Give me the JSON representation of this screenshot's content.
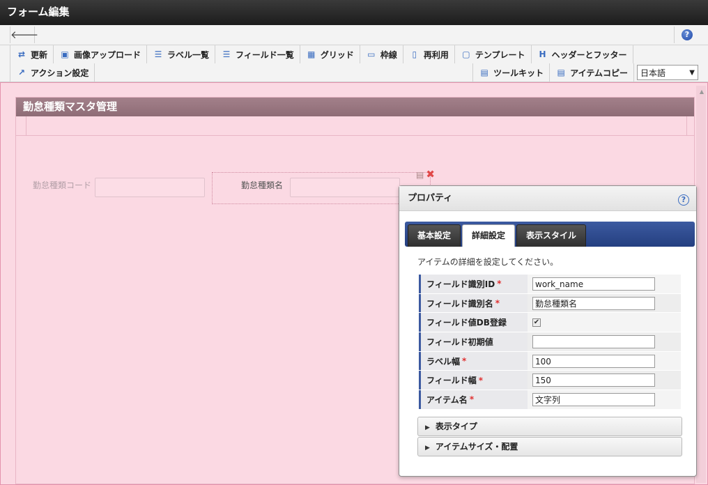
{
  "window": {
    "title": "フォーム編集"
  },
  "nav": {
    "back_icon": "arrow-left-icon",
    "help_label": "?"
  },
  "toolbar": {
    "row1": [
      {
        "label": "更新",
        "icon": "refresh-icon",
        "glyph": "⇄"
      },
      {
        "label": "画像アップロード",
        "icon": "image-upload-icon",
        "glyph": "▣"
      },
      {
        "label": "ラベル一覧",
        "icon": "list-icon",
        "glyph": "☰"
      },
      {
        "label": "フィールド一覧",
        "icon": "list-icon",
        "glyph": "☰"
      },
      {
        "label": "グリッド",
        "icon": "grid-icon",
        "glyph": "▦"
      },
      {
        "label": "枠線",
        "icon": "border-icon",
        "glyph": "▭"
      },
      {
        "label": "再利用",
        "icon": "document-icon",
        "glyph": "▯"
      },
      {
        "label": "テンプレート",
        "icon": "template-icon",
        "glyph": "▢"
      },
      {
        "label": "ヘッダーとフッター",
        "icon": "header-icon",
        "glyph": "H"
      }
    ],
    "row2_left": [
      {
        "label": "アクション設定",
        "icon": "action-icon",
        "glyph": "↗"
      }
    ],
    "row2_right": [
      {
        "label": "ツールキット",
        "icon": "toolbox-icon",
        "glyph": "▤"
      },
      {
        "label": "アイテムコピー",
        "icon": "toolbox-icon",
        "glyph": "▤"
      }
    ],
    "language": {
      "selected": "日本語"
    }
  },
  "form": {
    "title": "勤怠種類マスタ管理",
    "fields": [
      {
        "label": "勤怠種類コード"
      },
      {
        "label": "勤怠種類名"
      }
    ]
  },
  "properties": {
    "title": "プロパティ",
    "help_label": "?",
    "tabs": [
      {
        "label": "基本設定",
        "active": false
      },
      {
        "label": "詳細設定",
        "active": true
      },
      {
        "label": "表示スタイル",
        "active": false
      }
    ],
    "description": "アイテムの詳細を設定してください。",
    "rows": [
      {
        "label": "フィールド識別ID",
        "required": true,
        "type": "text",
        "value": "work_name"
      },
      {
        "label": "フィールド識別名",
        "required": true,
        "type": "text",
        "value": "勤怠種類名"
      },
      {
        "label": "フィールド値DB登録",
        "required": false,
        "type": "checkbox",
        "checked": true
      },
      {
        "label": "フィールド初期値",
        "required": false,
        "type": "text",
        "value": ""
      },
      {
        "label": "ラベル幅",
        "required": true,
        "type": "text",
        "value": "100"
      },
      {
        "label": "フィールド幅",
        "required": true,
        "type": "text",
        "value": "150"
      },
      {
        "label": "アイテム名",
        "required": true,
        "type": "text",
        "value": "文字列"
      }
    ],
    "sections": [
      {
        "label": "表示タイプ"
      },
      {
        "label": "アイテムサイズ・配置"
      }
    ]
  }
}
